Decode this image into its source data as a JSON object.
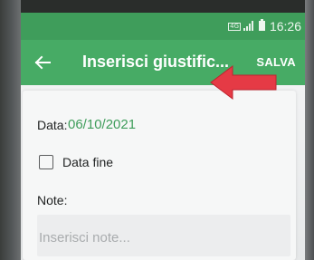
{
  "status_bar": {
    "network_label": "4G",
    "time": "16:26"
  },
  "app_bar": {
    "title": "Inserisci giustific...",
    "save_label": "SALVA",
    "back_icon": "arrow-left-icon"
  },
  "form": {
    "date_label": "Data:",
    "date_value": "06/10/2021",
    "end_date_label": "Data fine",
    "end_date_checked": false,
    "notes_label": "Note:",
    "notes_placeholder": "Inserisci note...",
    "notes_value": ""
  },
  "colors": {
    "status_bar": "#3f9d5b",
    "app_bar": "#47ab65",
    "date_value": "#3f9d5b",
    "annotation_arrow": "#e53a45"
  }
}
